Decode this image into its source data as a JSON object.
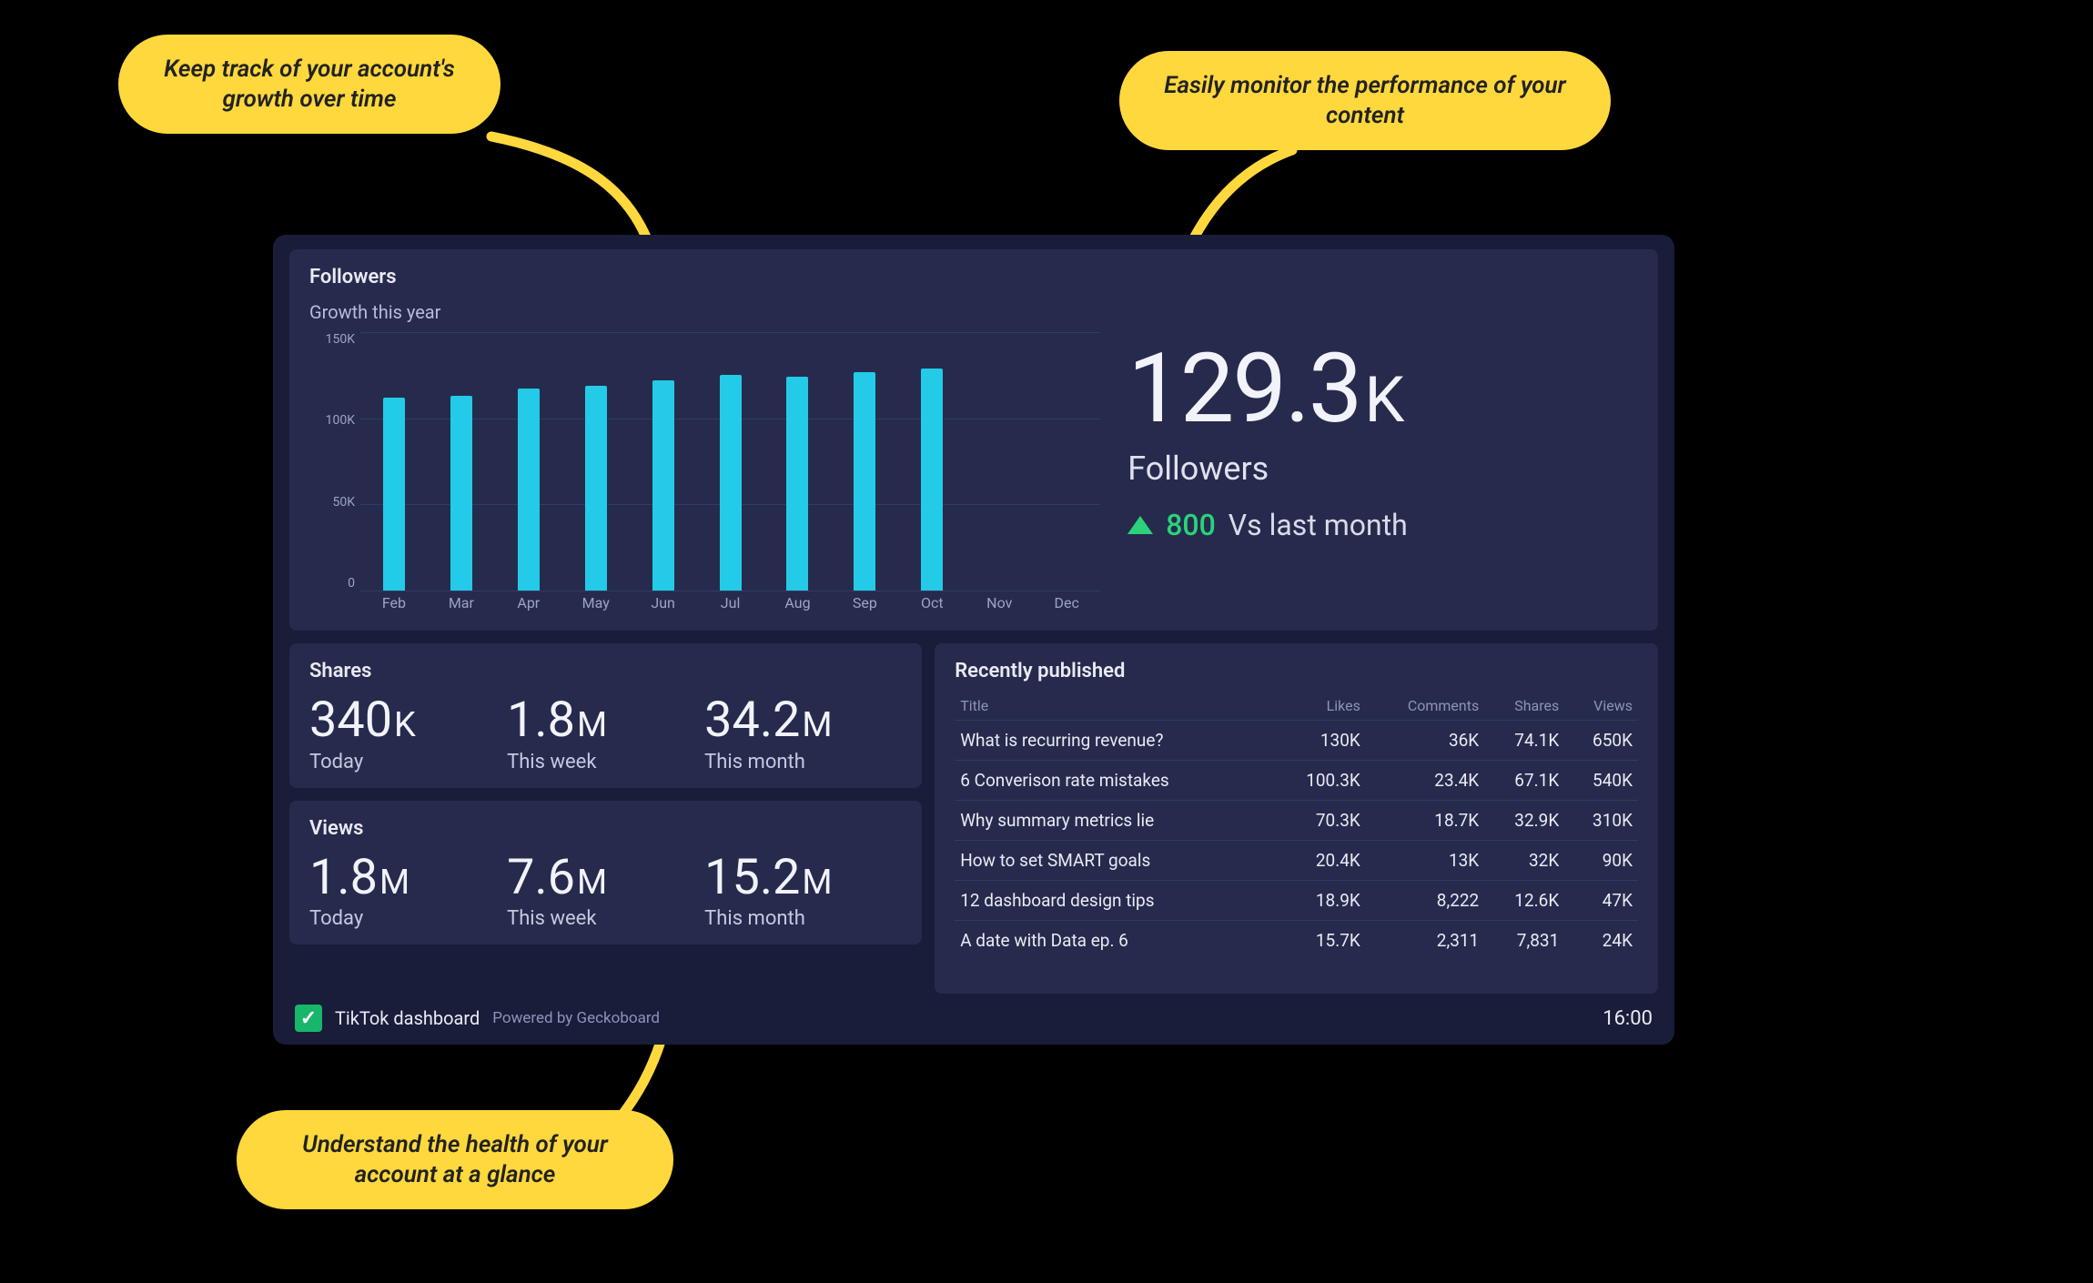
{
  "callouts": {
    "top_left": "Keep track of your account's growth over time",
    "top_right": "Easily monitor the performance of your content",
    "bottom": "Understand the health of your account at a glance"
  },
  "followers": {
    "title": "Followers",
    "subtitle": "Growth this year",
    "big_value": "129.3",
    "big_suffix": "K",
    "big_label": "Followers",
    "delta_value": "800",
    "delta_label": "Vs last month"
  },
  "shares": {
    "title": "Shares",
    "cells": [
      {
        "val": "340",
        "suf": "K",
        "lab": "Today"
      },
      {
        "val": "1.8",
        "suf": "M",
        "lab": "This week"
      },
      {
        "val": "34.2",
        "suf": "M",
        "lab": "This month"
      }
    ]
  },
  "views": {
    "title": "Views",
    "cells": [
      {
        "val": "1.8",
        "suf": "M",
        "lab": "Today"
      },
      {
        "val": "7.6",
        "suf": "M",
        "lab": "This week"
      },
      {
        "val": "15.2",
        "suf": "M",
        "lab": "This month"
      }
    ]
  },
  "recent": {
    "title": "Recently published",
    "headers": [
      "Title",
      "Likes",
      "Comments",
      "Shares",
      "Views"
    ],
    "rows": [
      {
        "title": "What is recurring revenue?",
        "likes": "130K",
        "comments": "36K",
        "shares": "74.1K",
        "views": "650K"
      },
      {
        "title": "6 Converison rate mistakes",
        "likes": "100.3K",
        "comments": "23.4K",
        "shares": "67.1K",
        "views": "540K"
      },
      {
        "title": "Why summary metrics lie",
        "likes": "70.3K",
        "comments": "18.7K",
        "shares": "32.9K",
        "views": "310K"
      },
      {
        "title": "How to set SMART goals",
        "likes": "20.4K",
        "comments": "13K",
        "shares": "32K",
        "views": "90K"
      },
      {
        "title": "12 dashboard design tips",
        "likes": "18.9K",
        "comments": "8,222",
        "shares": "12.6K",
        "views": "47K"
      },
      {
        "title": "A date with Data ep. 6",
        "likes": "15.7K",
        "comments": "2,311",
        "shares": "7,831",
        "views": "24K"
      }
    ]
  },
  "footer": {
    "name": "TikTok dashboard",
    "powered": "Powered by Geckoboard",
    "clock": "16:00"
  },
  "chart_data": {
    "type": "bar",
    "title": "Followers — Growth this year",
    "xlabel": "",
    "ylabel": "Followers",
    "y_ticks": [
      "150K",
      "100K",
      "50K",
      "0"
    ],
    "ylim": [
      0,
      150
    ],
    "categories": [
      "Feb",
      "Mar",
      "Apr",
      "May",
      "Jun",
      "Jul",
      "Aug",
      "Sep",
      "Oct",
      "Nov",
      "Dec"
    ],
    "values": [
      112,
      113,
      117,
      119,
      122,
      125,
      124,
      127,
      129,
      null,
      null
    ],
    "unit": "K"
  }
}
